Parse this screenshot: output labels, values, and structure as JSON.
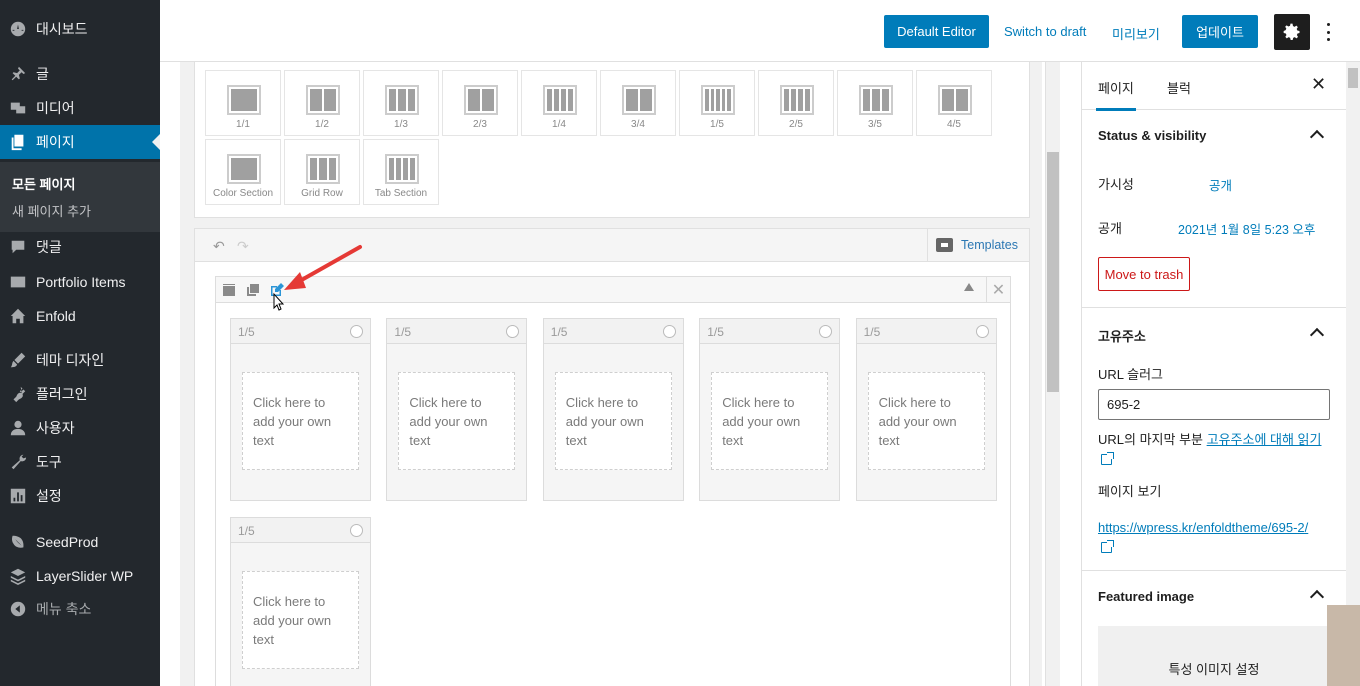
{
  "admin_menu": {
    "items": [
      {
        "id": "dashboard",
        "label": "대시보드",
        "icon": "dashboard-icon"
      },
      {
        "id": "posts",
        "label": "글",
        "icon": "pin-icon"
      },
      {
        "id": "media",
        "label": "미디어",
        "icon": "media-icon"
      },
      {
        "id": "pages",
        "label": "페이지",
        "icon": "pages-icon",
        "active": true
      },
      {
        "id": "comments",
        "label": "댓글",
        "icon": "comment-icon"
      },
      {
        "id": "portfolio",
        "label": "Portfolio Items",
        "icon": "portfolio-icon"
      },
      {
        "id": "enfold",
        "label": "Enfold",
        "icon": "home-icon"
      },
      {
        "id": "appearance",
        "label": "테마 디자인",
        "icon": "brush-icon"
      },
      {
        "id": "plugins",
        "label": "플러그인",
        "icon": "plugin-icon"
      },
      {
        "id": "users",
        "label": "사용자",
        "icon": "user-icon"
      },
      {
        "id": "tools",
        "label": "도구",
        "icon": "wrench-icon"
      },
      {
        "id": "settings",
        "label": "설정",
        "icon": "settings-icon"
      },
      {
        "id": "seedprod",
        "label": "SeedProd",
        "icon": "leaf-icon"
      },
      {
        "id": "layerslider",
        "label": "LayerSlider WP",
        "icon": "layers-icon"
      },
      {
        "id": "collapse",
        "label": "메뉴 축소",
        "icon": "collapse-icon"
      }
    ],
    "submenu": {
      "all_pages": "모든 페이지",
      "add_new": "새 페이지 추가"
    }
  },
  "topbar": {
    "default_editor": "Default Editor",
    "switch_to_draft": "Switch to draft",
    "preview": "미리보기",
    "update": "업데이트"
  },
  "layout_elements": [
    {
      "label": "1/1",
      "cols": 1
    },
    {
      "label": "1/2",
      "cols": 2
    },
    {
      "label": "1/3",
      "cols": 3
    },
    {
      "label": "2/3",
      "cols": 2
    },
    {
      "label": "1/4",
      "cols": 4
    },
    {
      "label": "3/4",
      "cols": 2
    },
    {
      "label": "1/5",
      "cols": 5
    },
    {
      "label": "2/5",
      "cols": 4
    },
    {
      "label": "3/5",
      "cols": 3
    },
    {
      "label": "4/5",
      "cols": 2
    },
    {
      "label": "Color Section",
      "cols": 1
    },
    {
      "label": "Grid Row",
      "cols": 3
    },
    {
      "label": "Tab Section",
      "cols": 4
    }
  ],
  "builder": {
    "templates_label": "Templates",
    "columns": [
      {
        "width": "1/5",
        "placeholder": "Click here to add your own text"
      },
      {
        "width": "1/5",
        "placeholder": "Click here to add your own text"
      },
      {
        "width": "1/5",
        "placeholder": "Click here to add your own text"
      },
      {
        "width": "1/5",
        "placeholder": "Click here to add your own text"
      },
      {
        "width": "1/5",
        "placeholder": "Click here to add your own text"
      },
      {
        "width": "1/5",
        "placeholder": "Click here to add your own text"
      }
    ]
  },
  "sidebar": {
    "tabs": {
      "page": "페이지",
      "block": "블럭"
    },
    "status_visibility": {
      "title": "Status & visibility",
      "visibility_label": "가시성",
      "visibility_value": "공개",
      "publish_label": "공개",
      "publish_value": "2021년 1월 8일 5:23 오후",
      "trash": "Move to trash"
    },
    "permalink": {
      "title": "고유주소",
      "slug_label": "URL 슬러그",
      "slug_value": "695-2",
      "help_prefix": "URL의 마지막 부분 ",
      "help_link": "고유주소에 대해 읽기",
      "view_page": "페이지 보기",
      "url": "https://wpress.kr/enfoldtheme/695-2/"
    },
    "featured_image": {
      "title": "Featured image",
      "set_label": "특성 이미지 설정"
    }
  },
  "colors": {
    "accent": "#007cba",
    "admin_bg": "#23282d",
    "annotation_arrow": "#e53935"
  }
}
